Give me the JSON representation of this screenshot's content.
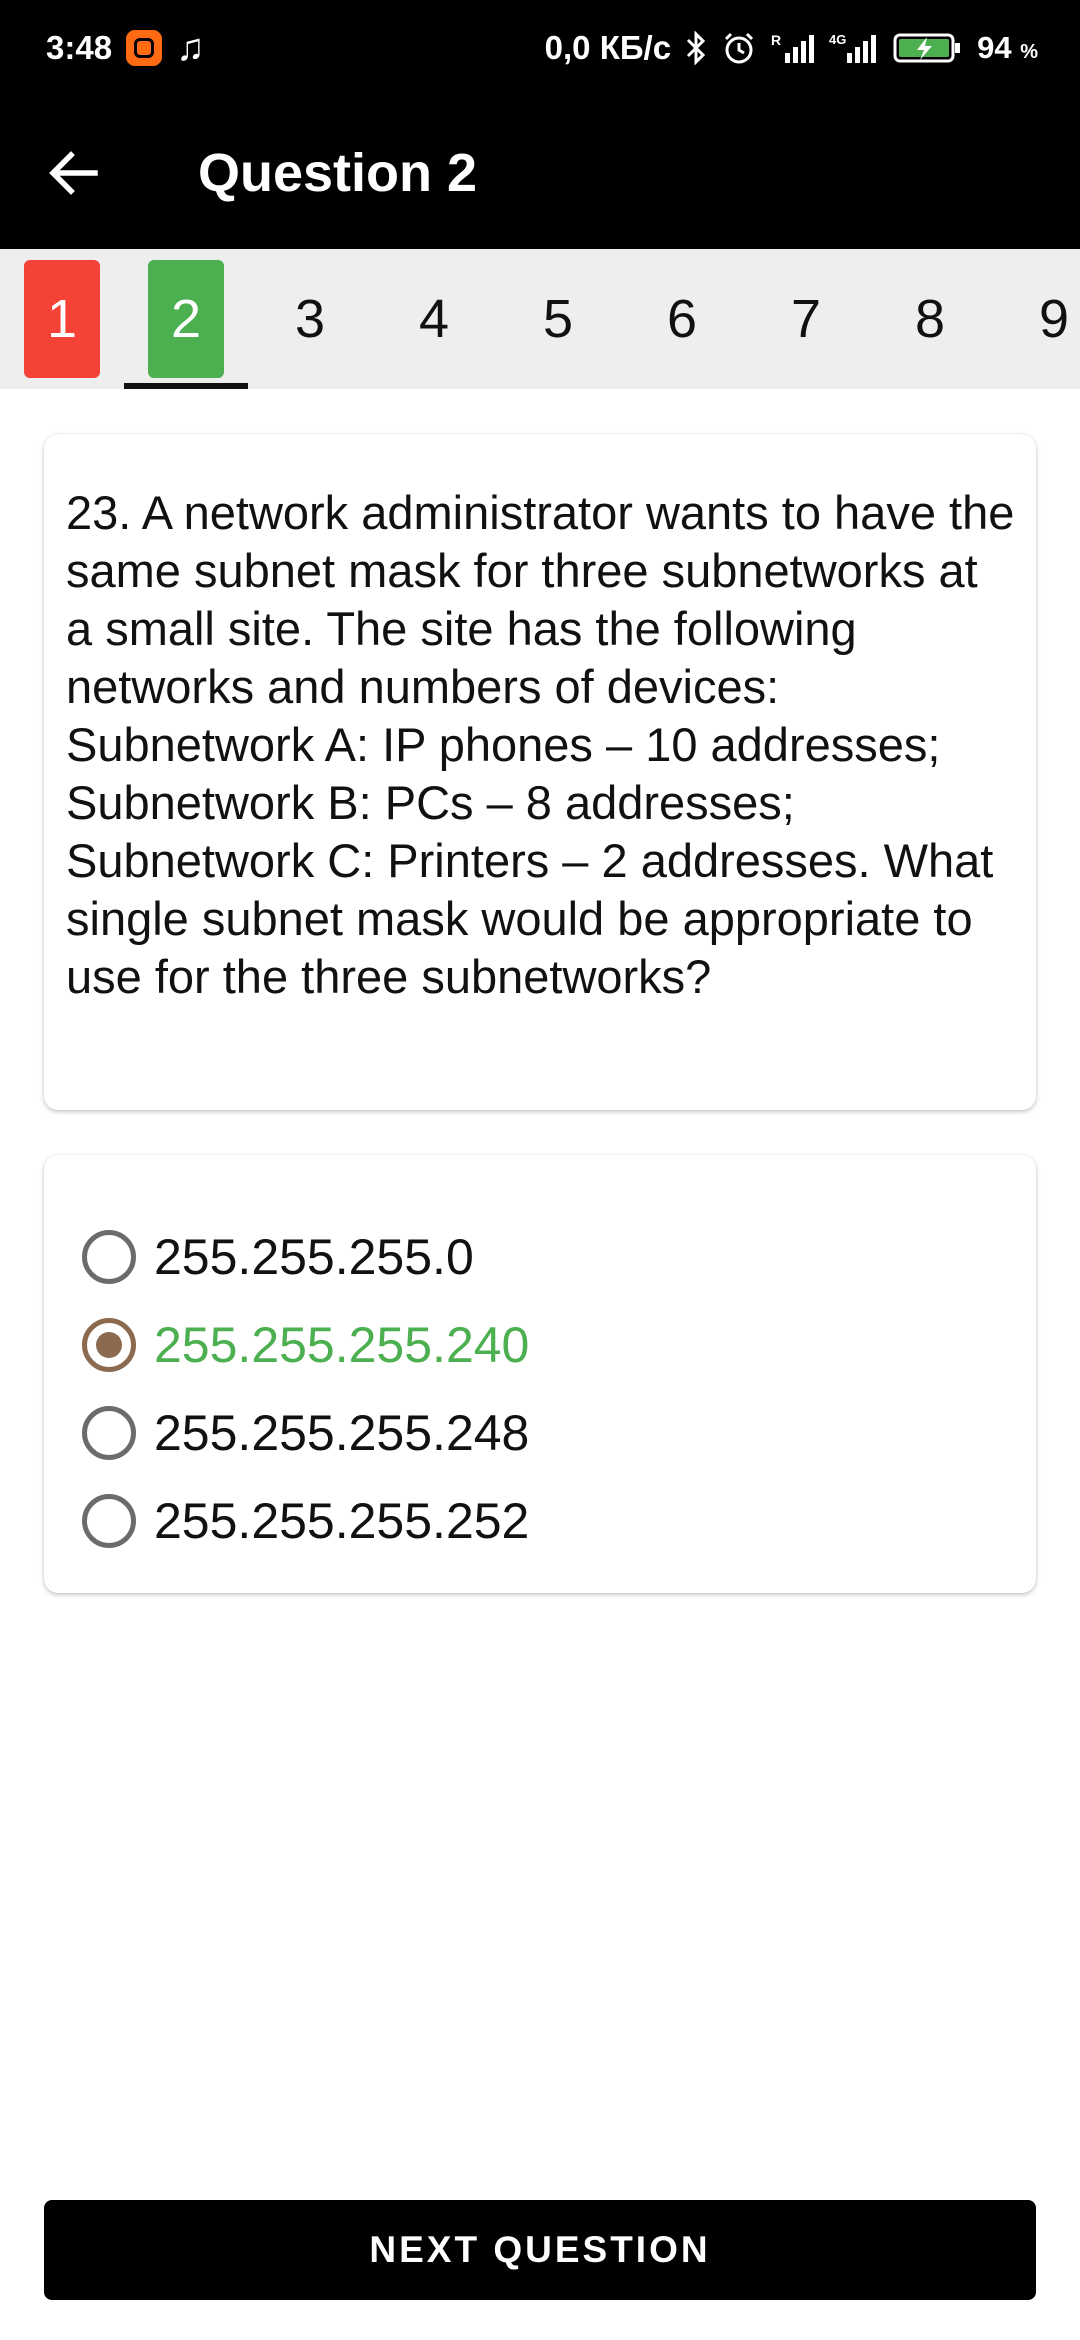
{
  "status_bar": {
    "time": "3:48",
    "network_speed": "0,0 КБ/с",
    "battery_percent": "94",
    "battery_unit": "%",
    "icons": [
      "mi-app-icon",
      "music-note-icon",
      "bluetooth-icon",
      "alarm-icon",
      "signal-roaming-icon",
      "signal-4g-icon",
      "battery-charging-icon"
    ]
  },
  "app_bar": {
    "title": "Question 2",
    "back_icon": "arrow-left-icon"
  },
  "tabs": [
    {
      "label": "1",
      "state": "wrong",
      "color": "#f44336"
    },
    {
      "label": "2",
      "state": "correct",
      "color": "#4caf50",
      "selected": true
    },
    {
      "label": "3"
    },
    {
      "label": "4"
    },
    {
      "label": "5"
    },
    {
      "label": "6"
    },
    {
      "label": "7"
    },
    {
      "label": "8"
    },
    {
      "label": "9"
    }
  ],
  "question": {
    "text": "23. A network administrator wants to have the same subnet mask for three subnetworks at a small site. The site has the following networks and numbers of devices: Subnetwork A: IP phones – 10 addresses; Subnetwork B: PCs – 8 addresses; Subnetwork C: Printers – 2 addresses. What single subnet mask would be appropriate to use for the three subnetworks?"
  },
  "options": [
    {
      "label": "255.255.255.0",
      "checked": false
    },
    {
      "label": "255.255.255.240",
      "checked": true,
      "correct": true
    },
    {
      "label": "255.255.255.248",
      "checked": false
    },
    {
      "label": "255.255.255.252",
      "checked": false
    }
  ],
  "next_button": {
    "label": "NEXT QUESTION"
  },
  "colors": {
    "bar_background": "#000000",
    "correct": "#4caf50",
    "wrong": "#f44336",
    "radio_selected": "#8b6a4f"
  }
}
